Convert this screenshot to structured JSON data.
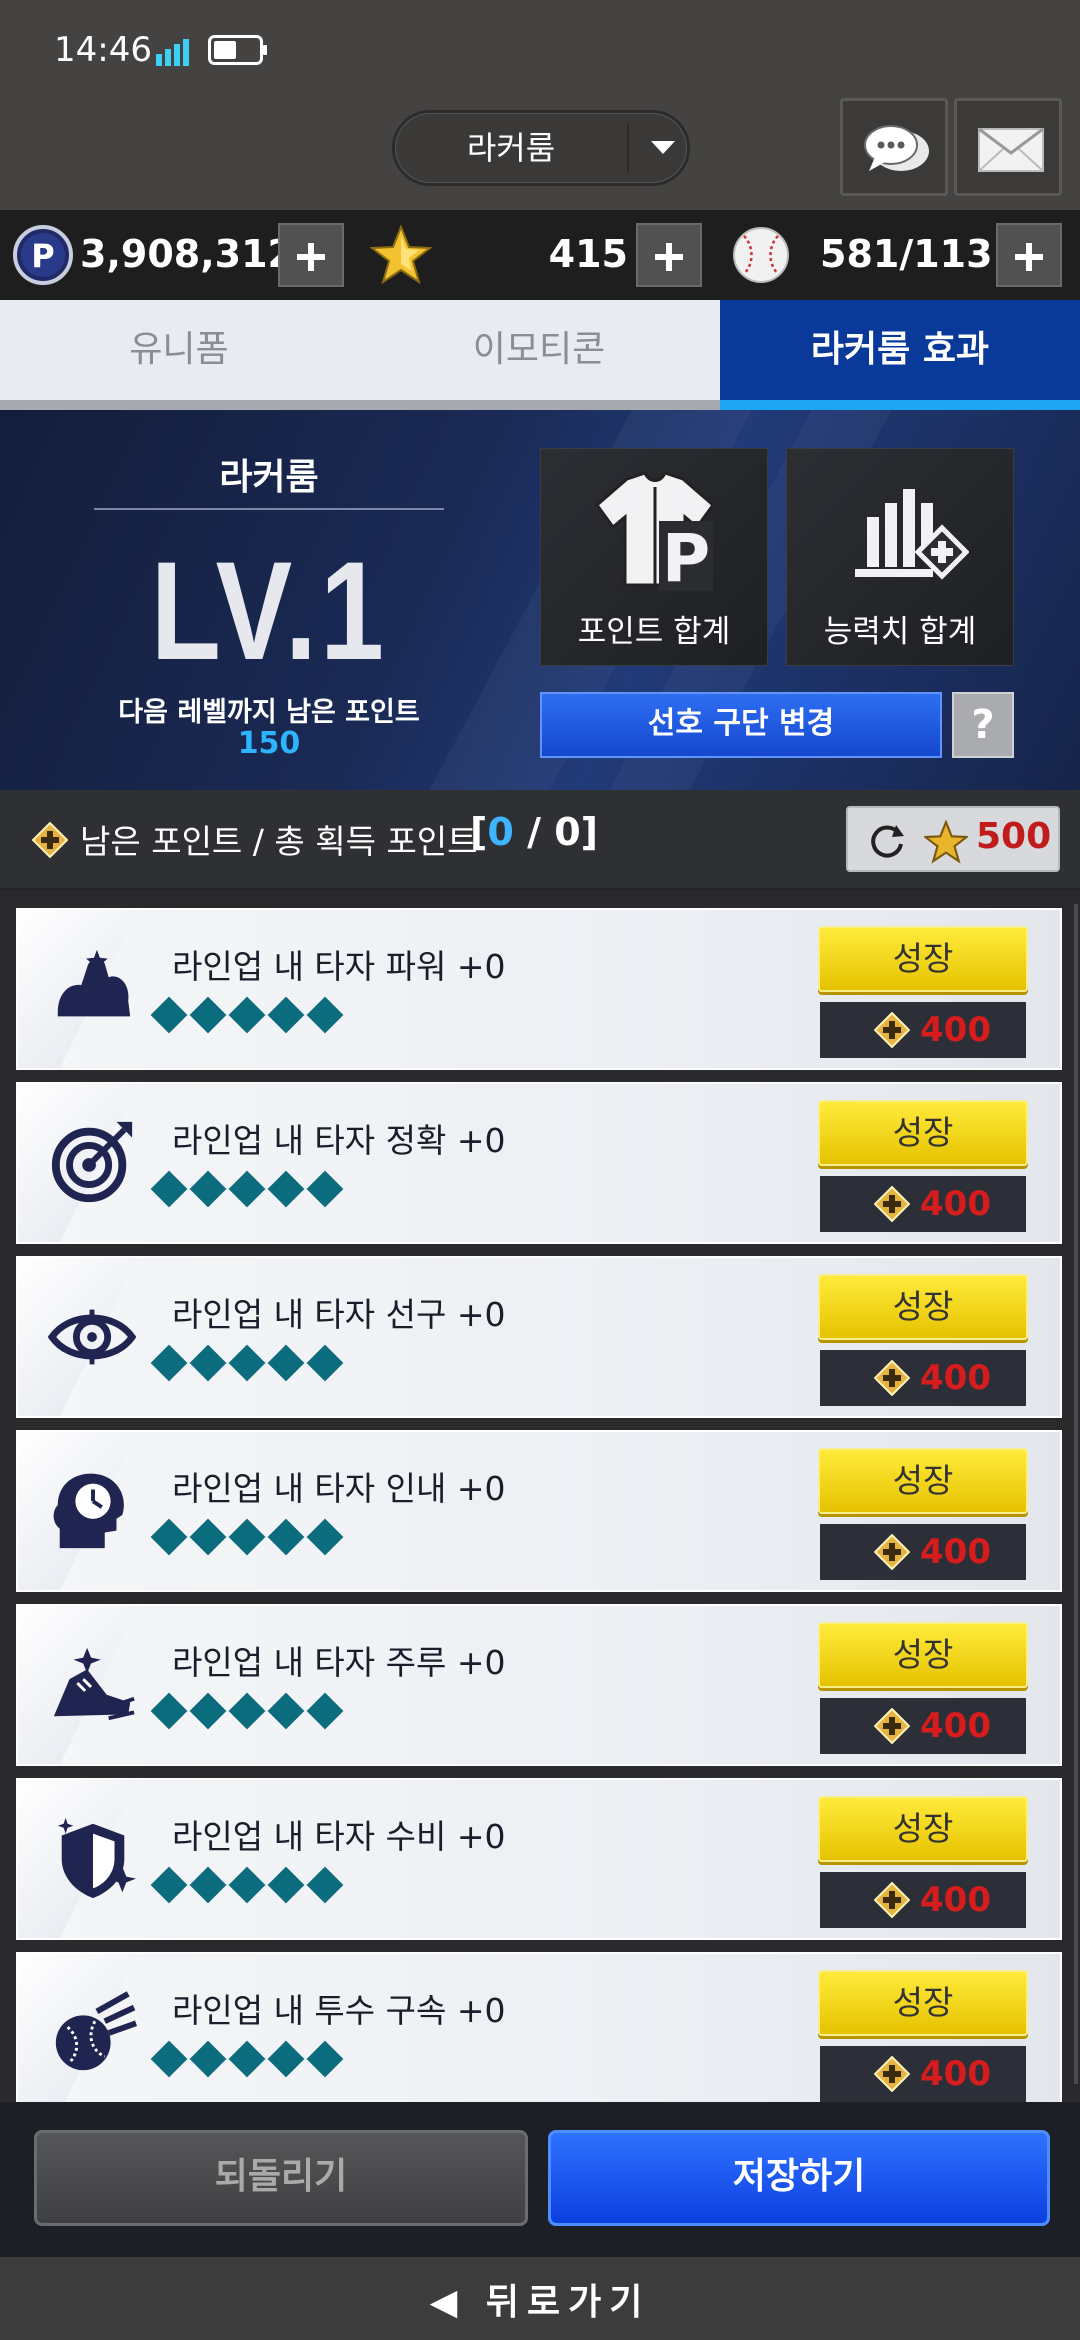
{
  "status": {
    "time": "14:46"
  },
  "header": {
    "room_select": "라커룸",
    "chat_icon": "chat-bubbles-icon",
    "mail_icon": "envelope-icon"
  },
  "currency": {
    "points": "3,908,312",
    "stars": "415",
    "balls": "581/113"
  },
  "tabs": [
    {
      "label": "유니폼",
      "active": false
    },
    {
      "label": "이모티콘",
      "active": false
    },
    {
      "label": "라커룸 효과",
      "active": true
    }
  ],
  "level_panel": {
    "title": "라커룸",
    "level": "LV.1",
    "next_label": "다음 레벨까지 남은 포인트",
    "next_value": "150",
    "card_points": "포인트 합계",
    "card_stats": "능력치 합계",
    "pref_button": "선호 구단 변경",
    "help": "?"
  },
  "points": {
    "label": "남은 포인트 / 총 획득 포인트",
    "open": "[",
    "remaining": "0",
    "sep": "/",
    "total": "0",
    "close": "]",
    "reset_cost": "500"
  },
  "effects": [
    {
      "label": "라인업 내 타자 파워 +0",
      "icon": "flexed-arm-icon",
      "button": "성장",
      "cost": "400"
    },
    {
      "label": "라인업 내 타자 정확 +0",
      "icon": "target-icon",
      "button": "성장",
      "cost": "400"
    },
    {
      "label": "라인업 내 타자 선구 +0",
      "icon": "eye-icon",
      "button": "성장",
      "cost": "400"
    },
    {
      "label": "라인업 내 타자 인내 +0",
      "icon": "head-clock-icon",
      "button": "성장",
      "cost": "400"
    },
    {
      "label": "라인업 내 타자 주루 +0",
      "icon": "running-shoe-icon",
      "button": "성장",
      "cost": "400"
    },
    {
      "label": "라인업 내 타자 수비 +0",
      "icon": "shield-icon",
      "button": "성장",
      "cost": "400"
    },
    {
      "label": "라인업 내 투수 구속 +0",
      "icon": "fastball-icon",
      "button": "성장",
      "cost": "400"
    }
  ],
  "footer": {
    "undo": "되돌리기",
    "save": "저장하기",
    "back": "◀ 뒤로가기"
  },
  "colors": {
    "accent_blue": "#0a3a99",
    "tab_underline": "#1ea6f2",
    "grow_yellow": "#ffe03a",
    "cost_red": "#d61c1c",
    "gem_teal": "#0b6c7e"
  }
}
